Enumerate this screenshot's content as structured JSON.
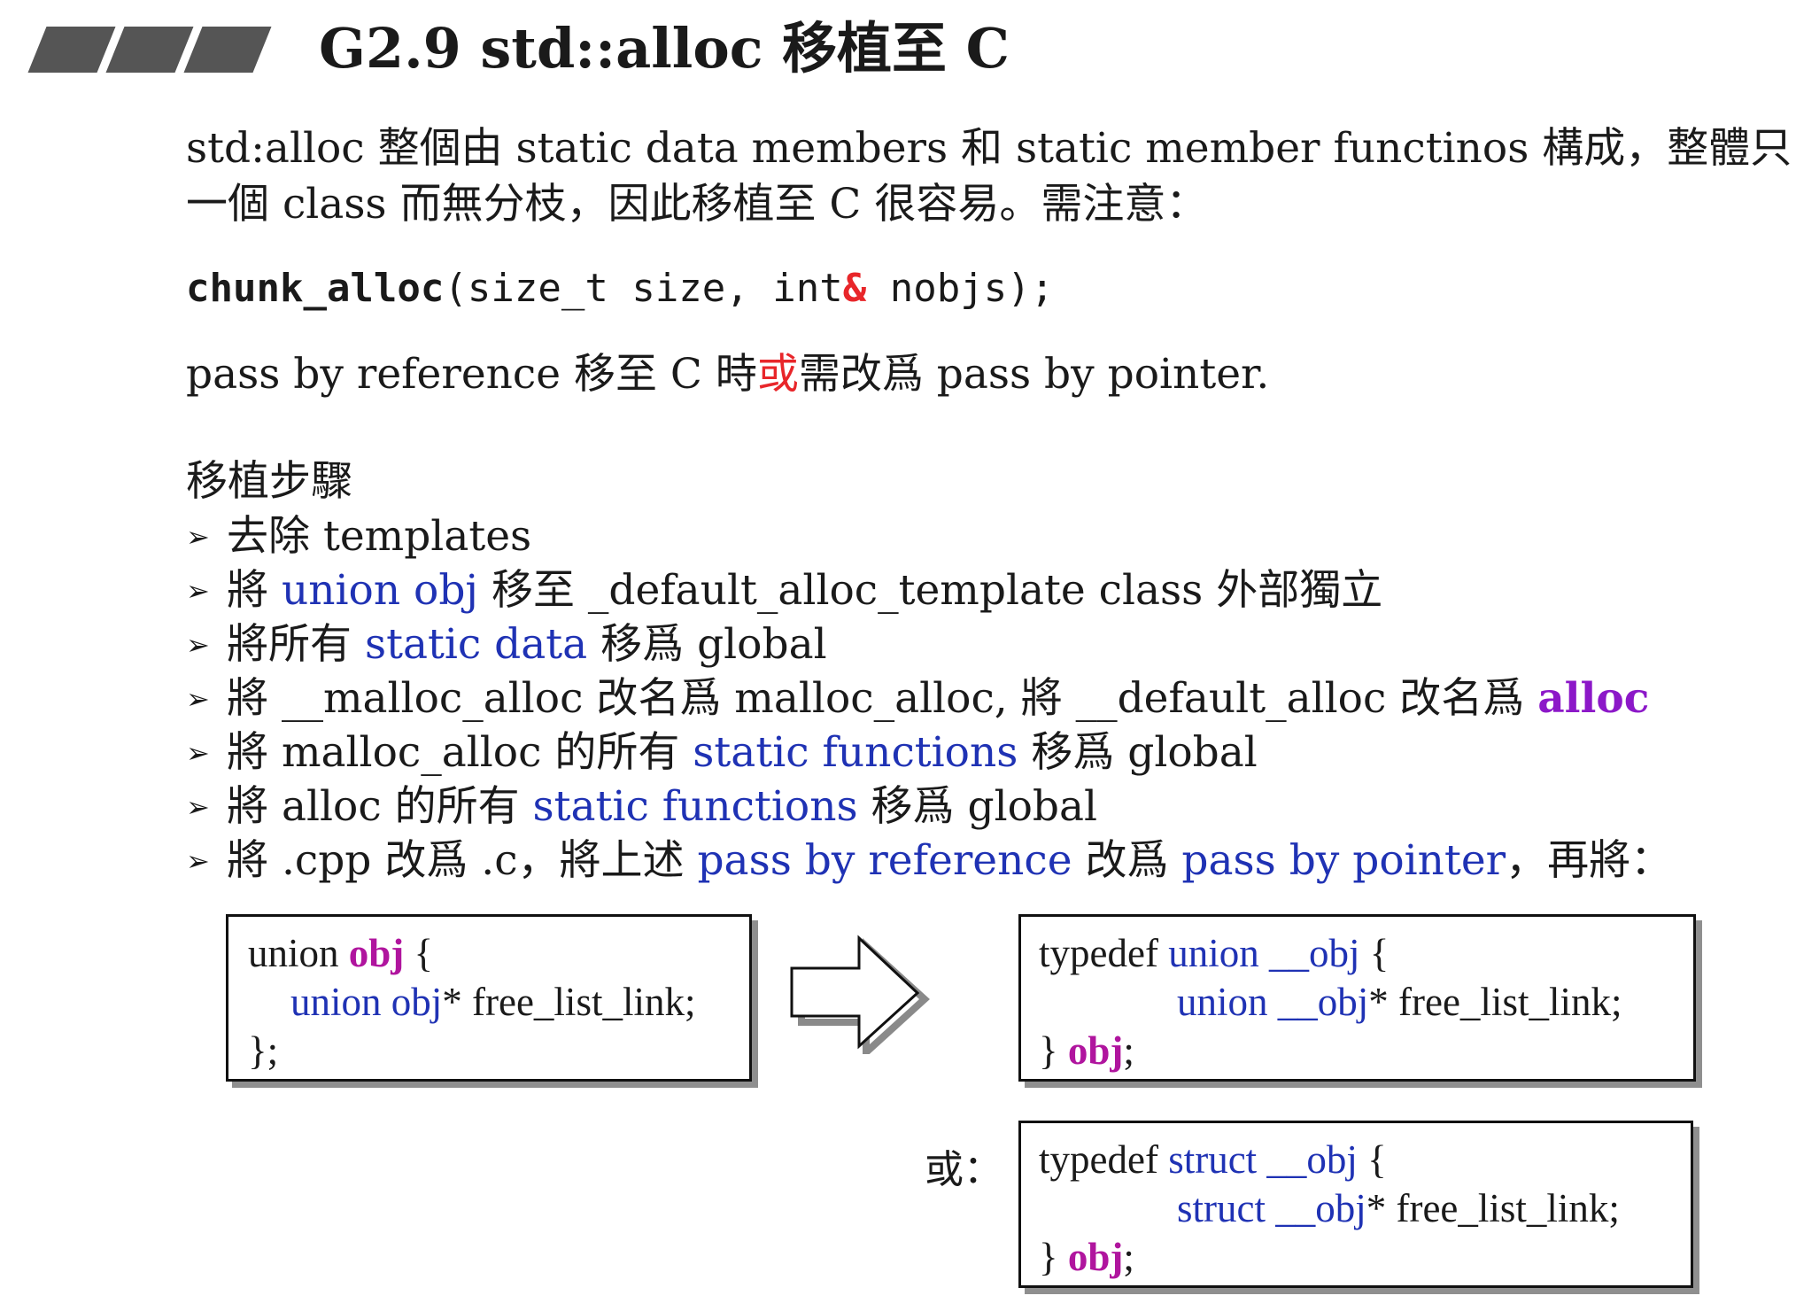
{
  "title": "G2.9 std::alloc 移植至 C",
  "intro": {
    "line1": "std:alloc 整個由 static data members 和 static member functinos 構成，整體只",
    "line2": "一個 class 而無分枝，因此移植至 C 很容易。需注意："
  },
  "code_sig": {
    "fn": "chunk_alloc",
    "args_a": "(size_t size, int",
    "amp": "&",
    "args_b": " nobjs);"
  },
  "pass_note": {
    "a": "pass by reference 移至 C 時",
    "b": "或",
    "c": "需改爲 pass by pointer."
  },
  "steps_heading": "移植步驟",
  "bullet_glyph": "➢",
  "steps": [
    {
      "a": "去除 templates"
    },
    {
      "a": "將 ",
      "b": "union obj",
      "c": " 移至 _default_alloc_template class 外部獨立"
    },
    {
      "a": "將所有 ",
      "b": "static data",
      "c": " 移爲 global"
    },
    {
      "a": "將 __malloc_alloc 改名爲 malloc_alloc, 將 __default_alloc 改名爲 ",
      "b": "alloc"
    },
    {
      "a": "將 malloc_alloc 的所有 ",
      "b": "static functions",
      "c": " 移爲 global"
    },
    {
      "a": "將 alloc 的所有 ",
      "b": "static functions",
      "c": " 移爲 global"
    },
    {
      "a": "將 .cpp 改爲 .c，將上述 ",
      "b": "pass by reference",
      "c": " 改爲 ",
      "d": "pass by pointer",
      "e": "，再將："
    }
  ],
  "box_left": {
    "l1a": "union ",
    "l1b": "obj",
    "l1c": " {",
    "l2a": "union obj",
    "l2b": "* free_list_link;",
    "l3": "};"
  },
  "box_union": {
    "l1a": "typedef ",
    "l1b": "union __obj",
    "l1c": " {",
    "l2a": "union __obj",
    "l2b": "* free_list_link;",
    "l3a": "} ",
    "l3b": "obj",
    "l3c": ";"
  },
  "or_label": "或：",
  "box_struct": {
    "l1a": "typedef ",
    "l1b": "struct __obj",
    "l1c": " {",
    "l2a": "struct __obj",
    "l2b": "* free_list_link;",
    "l3a": "} ",
    "l3b": "obj",
    "l3c": ";"
  },
  "colors": {
    "keyword_blue": "#1f32b4",
    "highlight_purple": "#8c18c8",
    "highlight_red": "#e8262a",
    "obj_magenta": "#b0159e"
  }
}
